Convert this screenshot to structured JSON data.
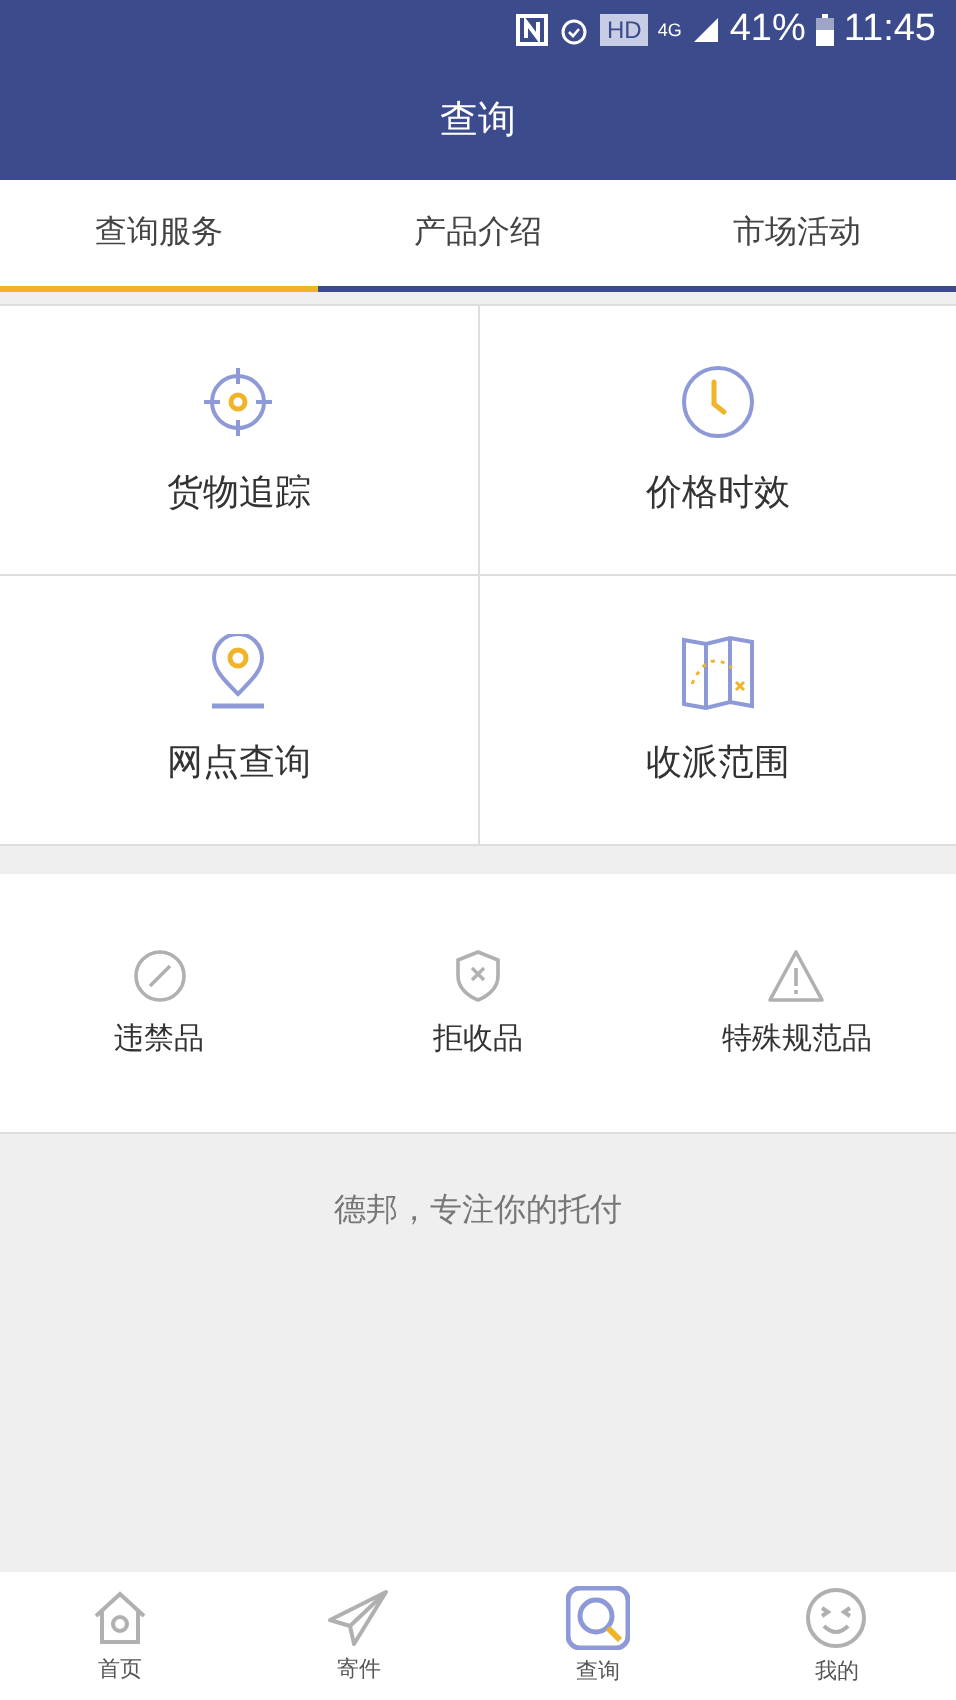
{
  "status_bar": {
    "network": "4G",
    "hd": "HD",
    "battery": "41%",
    "time": "11:45"
  },
  "header": {
    "title": "查询"
  },
  "tabs": [
    {
      "label": "查询服务",
      "selected": true
    },
    {
      "label": "产品介绍",
      "selected": false
    },
    {
      "label": "市场活动",
      "selected": false
    }
  ],
  "services": [
    {
      "kind": "target",
      "label": "货物追踪"
    },
    {
      "kind": "clock",
      "label": "价格时效"
    },
    {
      "kind": "pin",
      "label": "网点查询"
    },
    {
      "kind": "map",
      "label": "收派范围"
    }
  ],
  "goods": [
    {
      "kind": "forbidden",
      "label": "违禁品"
    },
    {
      "kind": "shield",
      "label": "拒收品"
    },
    {
      "kind": "warning",
      "label": "特殊规范品"
    }
  ],
  "slogan": "德邦，专注你的托付",
  "bottom_nav": [
    {
      "kind": "home",
      "label": "首页",
      "selected": false
    },
    {
      "kind": "send",
      "label": "寄件",
      "selected": false
    },
    {
      "kind": "search",
      "label": "查询",
      "selected": true
    },
    {
      "kind": "me",
      "label": "我的",
      "selected": false
    }
  ]
}
